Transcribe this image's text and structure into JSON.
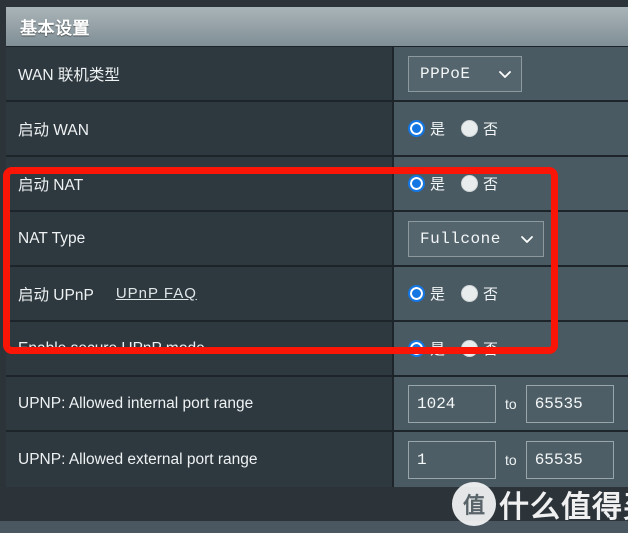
{
  "panel": {
    "header_title": "基本设置"
  },
  "rows": [
    {
      "label": "WAN 联机类型",
      "control": "select",
      "select_value": "PPPoE"
    },
    {
      "label": "启动 WAN",
      "control": "radio",
      "yes_label": "是",
      "no_label": "否",
      "selected": "yes"
    },
    {
      "label": "启动 NAT",
      "control": "radio",
      "yes_label": "是",
      "no_label": "否",
      "selected": "yes"
    },
    {
      "label": "NAT Type",
      "control": "select",
      "select_value": "Fullcone"
    },
    {
      "label": "启动 UPnP",
      "link_label": "UPnP  FAQ",
      "control": "radio",
      "yes_label": "是",
      "no_label": "否",
      "selected": "yes"
    },
    {
      "label": "Enable secure UPnP mode",
      "control": "radio",
      "yes_label": "是",
      "no_label": "否",
      "selected": "yes"
    },
    {
      "label": "UPNP: Allowed internal port range",
      "control": "range",
      "from_value": "1024",
      "to_label": "to",
      "to_value": "65535"
    },
    {
      "label": "UPNP: Allowed external port range",
      "control": "range",
      "from_value": "1",
      "to_label": "to",
      "to_value": "65535"
    }
  ],
  "annotation": {
    "color": "#fb1507"
  },
  "watermark": {
    "badge_char": "值",
    "text": "什么值得买"
  },
  "colors": {
    "accent_radio": "#1476e2",
    "label_bg": "#2e383f",
    "value_bg": "#4a5a62",
    "annotation_red": "#fb1507"
  }
}
